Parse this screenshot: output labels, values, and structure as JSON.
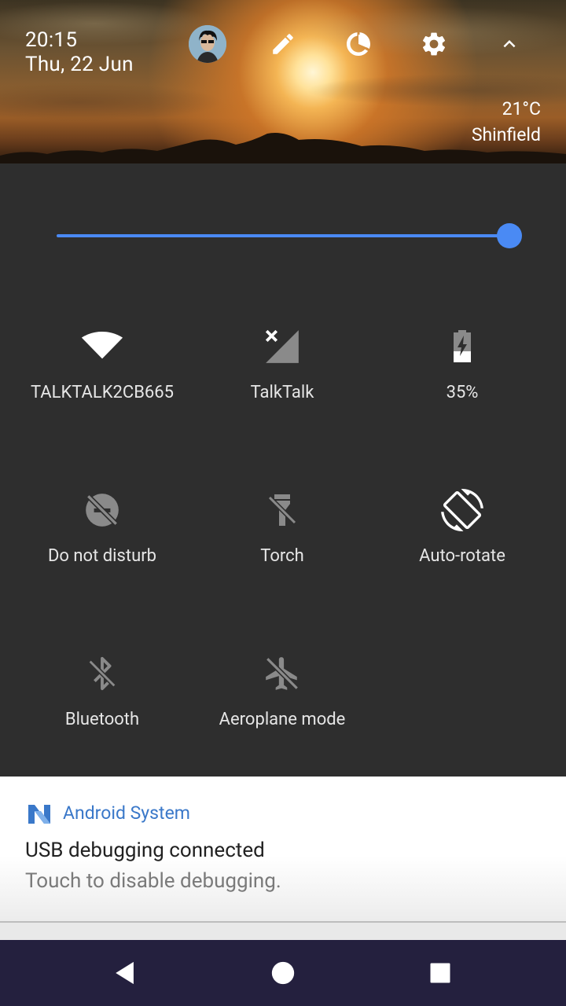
{
  "header": {
    "time": "20:15",
    "date": "Thu, 22 Jun",
    "weather_temp": "21°C",
    "weather_location": "Shinfield",
    "icons": [
      "user-avatar",
      "edit-icon",
      "data-usage-icon",
      "settings-icon",
      "collapse-chevron-icon"
    ]
  },
  "brightness": {
    "level_fraction": 1.0
  },
  "tiles": [
    {
      "label": "TALKTALK2CB665",
      "icon": "wifi-icon",
      "active": true
    },
    {
      "label": "TalkTalk",
      "icon": "mobile-signal-no-sim-icon",
      "active": false
    },
    {
      "label": "35%",
      "icon": "battery-charging-icon",
      "active": true
    },
    {
      "label": "Do not disturb",
      "icon": "do-not-disturb-off-icon",
      "active": false
    },
    {
      "label": "Torch",
      "icon": "torch-off-icon",
      "active": false
    },
    {
      "label": "Auto-rotate",
      "icon": "auto-rotate-icon",
      "active": true
    },
    {
      "label": "Bluetooth",
      "icon": "bluetooth-off-icon",
      "active": false
    },
    {
      "label": "Aeroplane mode",
      "icon": "airplane-off-icon",
      "active": false
    }
  ],
  "notification": {
    "app_name": "Android System",
    "title": "USB debugging connected",
    "text": "Touch to disable debugging."
  },
  "navbar": {
    "icons": [
      "back-icon",
      "home-icon",
      "recents-icon"
    ]
  },
  "colors": {
    "accent": "#4a8af4",
    "panel_bg": "#2e2e2e",
    "navbar_bg": "#24203e",
    "app_name": "#3a78c9"
  }
}
